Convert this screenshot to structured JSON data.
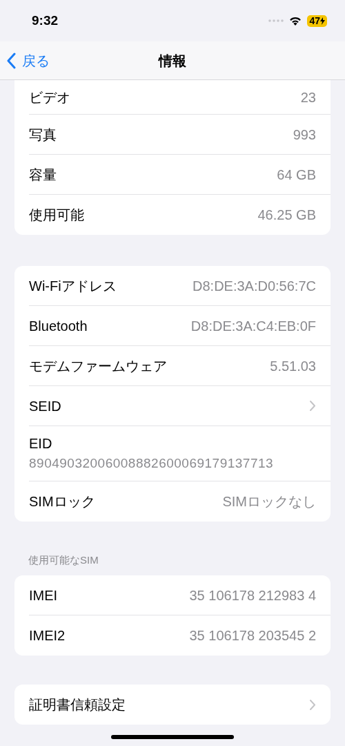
{
  "status_bar": {
    "time": "9:32",
    "battery": "47"
  },
  "nav": {
    "back": "戻る",
    "title": "情報"
  },
  "groups": [
    {
      "rows": [
        {
          "kind": "value",
          "label": "ビデオ",
          "value": "23"
        },
        {
          "kind": "value",
          "label": "写真",
          "value": "993"
        },
        {
          "kind": "value",
          "label": "容量",
          "value": "64 GB"
        },
        {
          "kind": "value",
          "label": "使用可能",
          "value": "46.25 GB"
        }
      ]
    },
    {
      "rows": [
        {
          "kind": "value",
          "label": "Wi-Fiアドレス",
          "value": "D8:DE:3A:D0:56:7C"
        },
        {
          "kind": "value",
          "label": "Bluetooth",
          "value": "D8:DE:3A:C4:EB:0F"
        },
        {
          "kind": "value",
          "label": "モデムファームウェア",
          "value": "5.51.03"
        },
        {
          "kind": "link",
          "label": "SEID"
        },
        {
          "kind": "stacked",
          "label": "EID",
          "value": "89049032006008882600069179137713"
        },
        {
          "kind": "value",
          "label": "SIMロック",
          "value": "SIMロックなし"
        }
      ]
    },
    {
      "header": "使用可能なSIM",
      "rows": [
        {
          "kind": "value",
          "label": "IMEI",
          "value": "35 106178 212983 4"
        },
        {
          "kind": "value",
          "label": "IMEI2",
          "value": "35 106178 203545 2"
        }
      ]
    },
    {
      "rows": [
        {
          "kind": "link",
          "label": "証明書信頼設定"
        }
      ]
    }
  ]
}
